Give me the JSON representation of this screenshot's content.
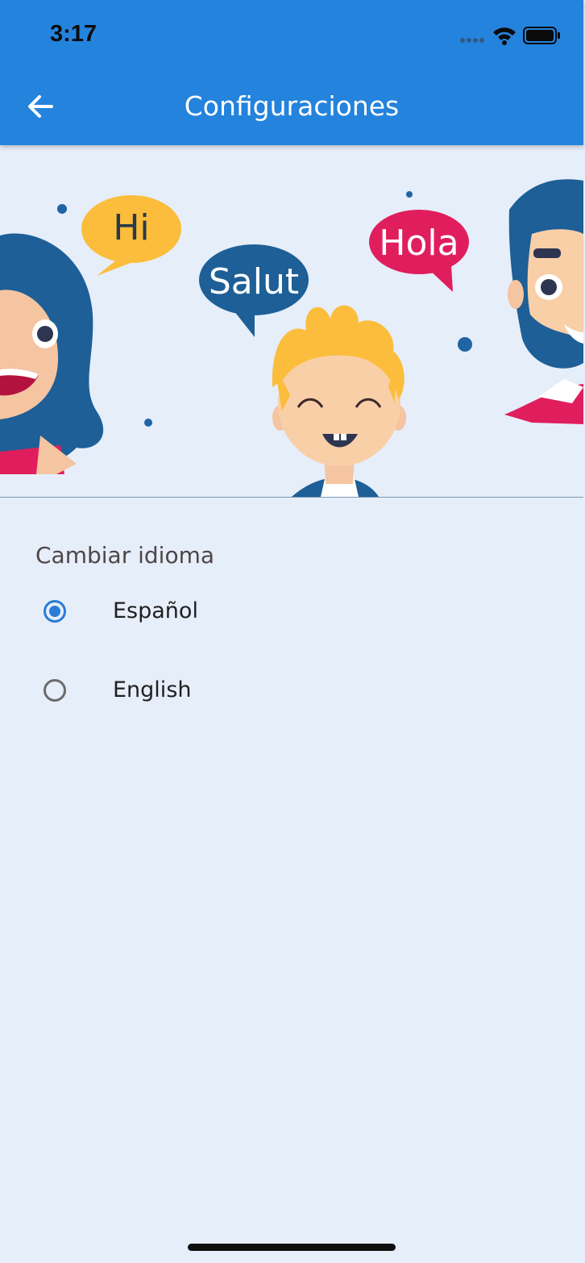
{
  "status_bar": {
    "time": "3:17"
  },
  "app_bar": {
    "title": "Configuraciones"
  },
  "hero": {
    "bubbles": [
      "Hi",
      "Salut",
      "Hola"
    ]
  },
  "language_section": {
    "title": "Cambiar idioma",
    "options": [
      {
        "label": "Español",
        "selected": true
      },
      {
        "label": "English",
        "selected": false
      }
    ]
  },
  "colors": {
    "primary": "#2483dd",
    "background": "#e6eefa",
    "radio_selected": "#2a7cd6"
  }
}
